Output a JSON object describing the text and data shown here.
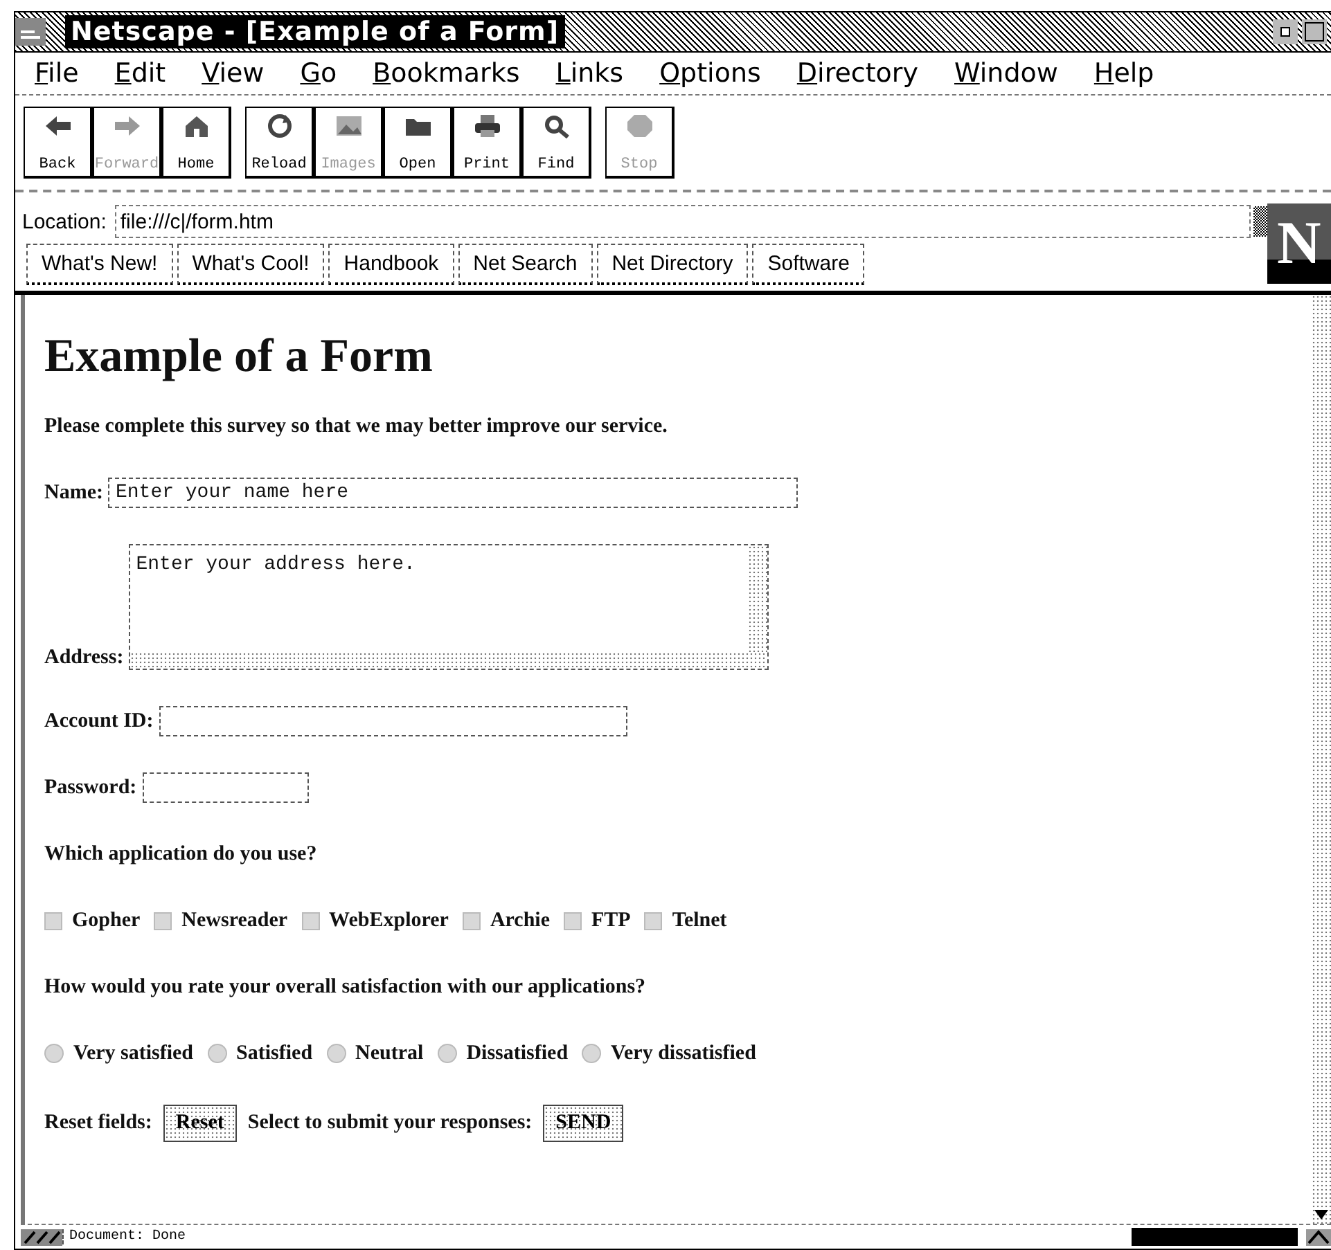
{
  "window": {
    "title": "Netscape - [Example of a Form]"
  },
  "menu": [
    "File",
    "Edit",
    "View",
    "Go",
    "Bookmarks",
    "Links",
    "Options",
    "Directory",
    "Window",
    "Help"
  ],
  "toolbar": [
    {
      "label": "Back",
      "disabled": false
    },
    {
      "label": "Forward",
      "disabled": true
    },
    {
      "label": "Home",
      "disabled": false
    },
    {
      "label": "Reload",
      "disabled": false
    },
    {
      "label": "Images",
      "disabled": true
    },
    {
      "label": "Open",
      "disabled": false
    },
    {
      "label": "Print",
      "disabled": false
    },
    {
      "label": "Find",
      "disabled": false
    },
    {
      "label": "Stop",
      "disabled": true
    }
  ],
  "location": {
    "label": "Location:",
    "value": "file:///c|/form.htm"
  },
  "logo": {
    "letter": "N"
  },
  "directory_buttons": [
    "What's New!",
    "What's Cool!",
    "Handbook",
    "Net Search",
    "Net Directory",
    "Software"
  ],
  "page": {
    "heading": "Example of a Form",
    "intro": "Please complete this survey so that we may better improve our service.",
    "name_field": {
      "label": "Name:",
      "value": "Enter your name here"
    },
    "address_field": {
      "label": "Address:",
      "value": "Enter your address here."
    },
    "account_field": {
      "label": "Account ID:"
    },
    "password_field": {
      "label": "Password:"
    },
    "question_1": "Which application do you use?",
    "applications": [
      {
        "label": "Gopher",
        "checked": false
      },
      {
        "label": "Newsreader",
        "checked": false
      },
      {
        "label": "WebExplorer",
        "checked": false
      },
      {
        "label": "Archie",
        "checked": false
      },
      {
        "label": "FTP",
        "checked": false
      },
      {
        "label": "Telnet",
        "checked": false
      }
    ],
    "question_2": "How would you rate your overall satisfaction with our applications?",
    "ratings": [
      {
        "label": "Very satisfied",
        "selected": false
      },
      {
        "label": "Satisfied",
        "selected": false
      },
      {
        "label": "Neutral",
        "selected": false
      },
      {
        "label": "Dissatisfied",
        "selected": false
      },
      {
        "label": "Very dissatisfied",
        "selected": false
      }
    ],
    "reset_label": "Reset fields:",
    "reset_button": "Reset",
    "submit_label": "Select to submit your responses:",
    "submit_button": "SEND"
  },
  "status_bar": {
    "text": "Document: Done",
    "progress": {
      "level": 1
    }
  }
}
